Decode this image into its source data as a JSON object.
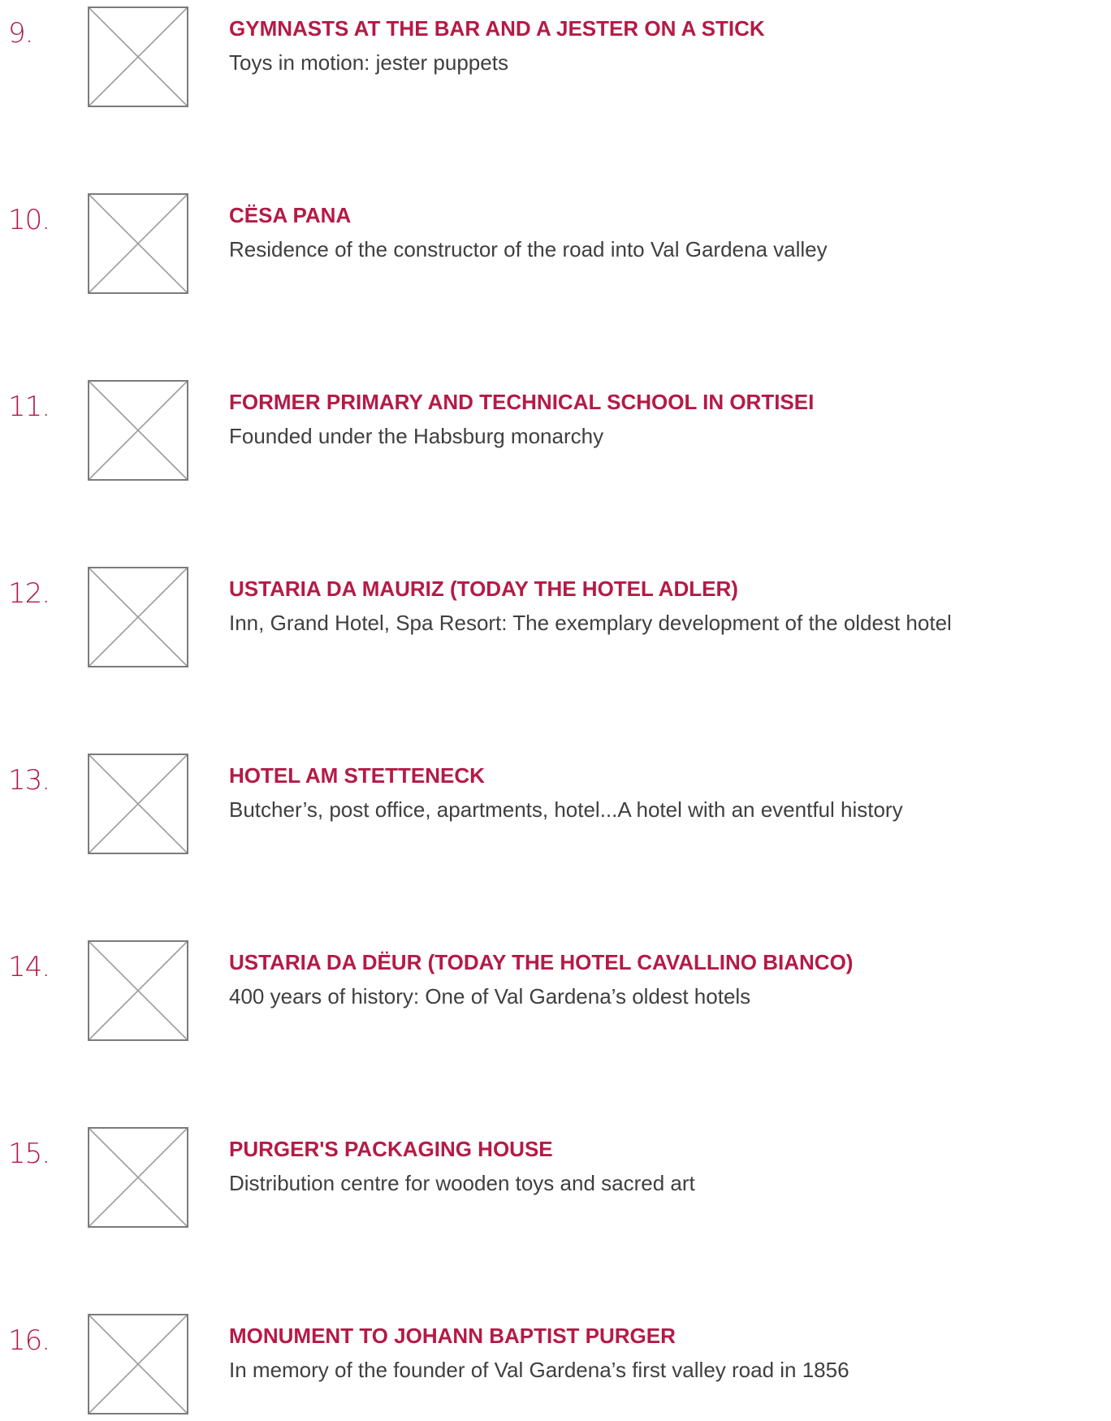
{
  "items": [
    {
      "number": "9.",
      "title": "GYMNASTS AT THE BAR AND A JESTER ON A STICK",
      "subtitle": "Toys in motion: jester puppets"
    },
    {
      "number": "10.",
      "title": "CËSA PANA",
      "subtitle": "Residence of the constructor of the road into Val Gardena valley"
    },
    {
      "number": "11.",
      "title": "FORMER PRIMARY AND TECHNICAL SCHOOL IN ORTISEI",
      "subtitle": "Founded under the Habsburg monarchy"
    },
    {
      "number": "12.",
      "title": "USTARIA DA MAURIZ (TODAY THE HOTEL ADLER)",
      "subtitle": "Inn, Grand Hotel, Spa Resort: The exemplary development of the oldest hotel"
    },
    {
      "number": "13.",
      "title": "HOTEL AM STETTENECK",
      "subtitle": "Butcher’s, post office, apartments, hotel...A hotel with an eventful history"
    },
    {
      "number": "14.",
      "title": "USTARIA DA DËUR (TODAY THE HOTEL CAVALLINO BIANCO)",
      "subtitle": "400 years of history: One of Val Gardena’s oldest hotels"
    },
    {
      "number": "15.",
      "title": "PURGER'S PACKAGING HOUSE",
      "subtitle": "Distribution centre for wooden toys and sacred art"
    },
    {
      "number": "16.",
      "title": "MONUMENT TO JOHANN BAPTIST PURGER",
      "subtitle": "In memory of the founder of Val Gardena’s first valley road in 1856"
    }
  ],
  "colors": {
    "accent": "#b51a46",
    "text": "#3f3f3f",
    "placeholder_border": "#7b7b7b"
  },
  "icons": {
    "thumbnail": "broken-image-placeholder-icon"
  }
}
